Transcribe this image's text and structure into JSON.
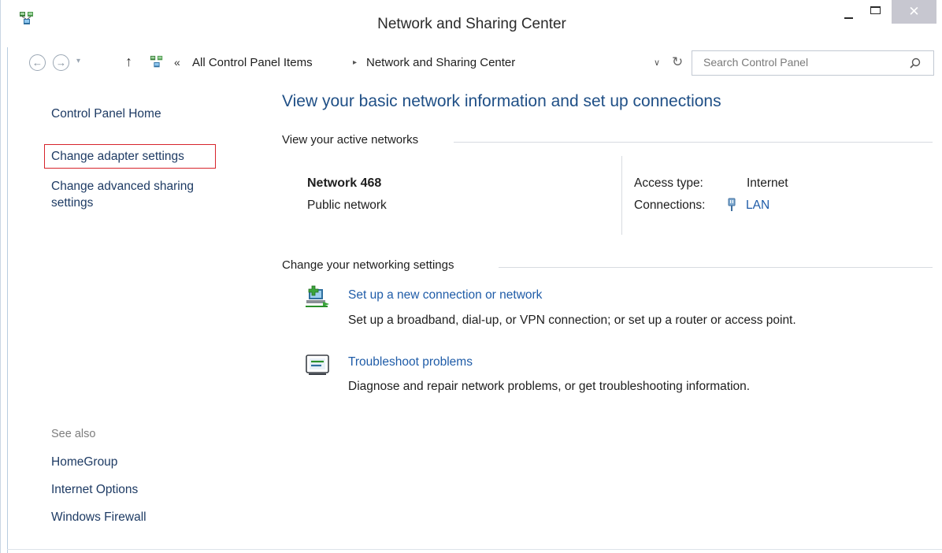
{
  "window": {
    "title": "Network and Sharing Center",
    "close_glyph": "✕"
  },
  "addressbar": {
    "chevron": "«",
    "breadcrumbs": [
      "All Control Panel Items",
      "Network and Sharing Center"
    ],
    "separator": "▸",
    "search_placeholder": "Search Control Panel"
  },
  "sidebar": {
    "home": "Control Panel Home",
    "adapter": "Change adapter settings",
    "sharing": "Change advanced sharing settings",
    "see_also": "See also",
    "links": [
      "HomeGroup",
      "Internet Options",
      "Windows Firewall"
    ]
  },
  "main": {
    "title": "View your basic network information and set up connections",
    "active_heading": "View your active networks",
    "network": {
      "name": "Network  468",
      "category": "Public network",
      "access_label": "Access type:",
      "access_value": "Internet",
      "connections_label": "Connections:",
      "connections_value": "LAN"
    },
    "change_heading": "Change your networking settings",
    "tasks": [
      {
        "link": "Set up a new connection or network",
        "description": "Set up a broadband, dial-up, or VPN connection; or set up a router or access point.",
        "icon": "new-connection-icon"
      },
      {
        "link": "Troubleshoot problems",
        "description": "Diagnose and repair network problems, or get troubleshooting information.",
        "icon": "troubleshoot-icon"
      }
    ]
  },
  "colors": {
    "link": "#1f5ca8",
    "title": "#1f4f86",
    "highlight_box": "#d7242b"
  }
}
